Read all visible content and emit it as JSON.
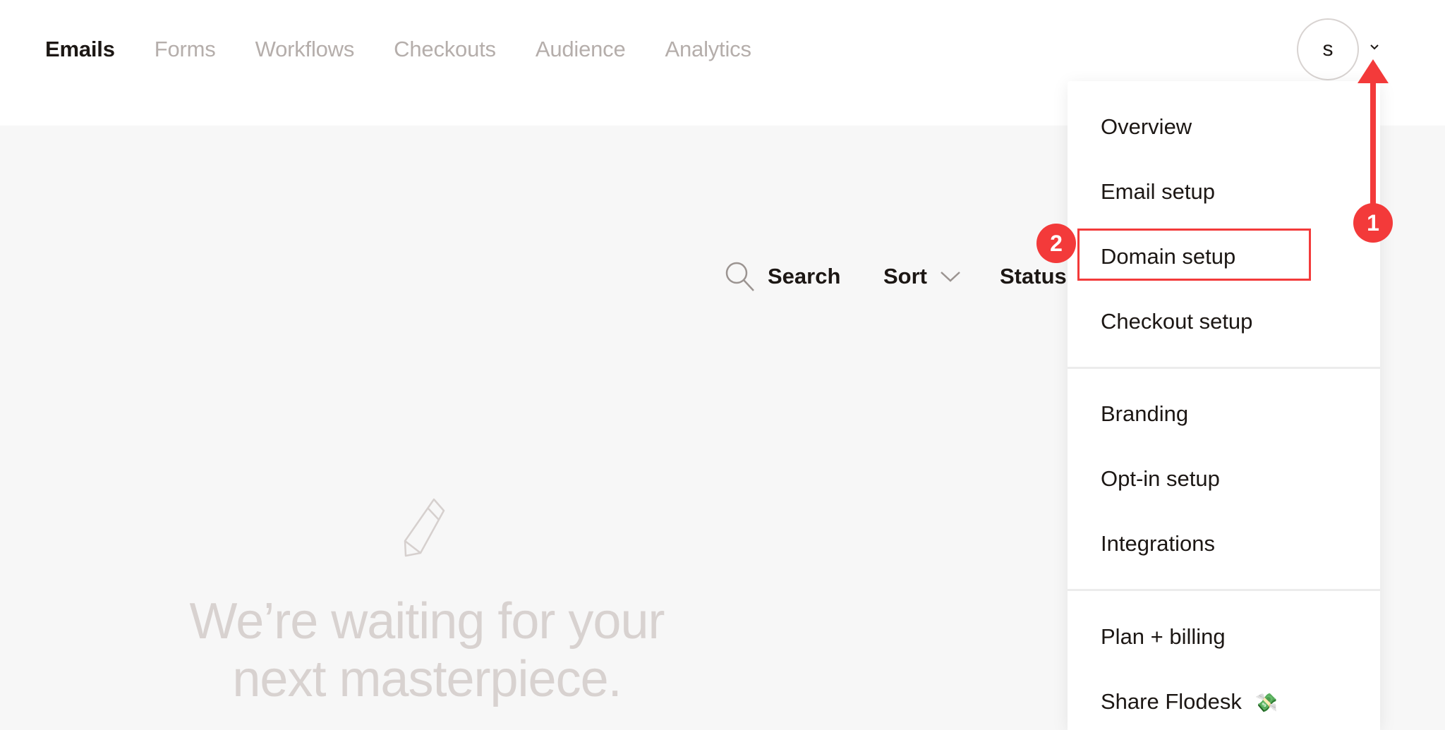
{
  "nav": {
    "items": [
      {
        "label": "Emails",
        "active": true
      },
      {
        "label": "Forms",
        "active": false
      },
      {
        "label": "Workflows",
        "active": false
      },
      {
        "label": "Checkouts",
        "active": false
      },
      {
        "label": "Audience",
        "active": false
      },
      {
        "label": "Analytics",
        "active": false
      }
    ]
  },
  "account": {
    "avatar_initial": "s",
    "chevron_icon": "chevron-down-icon"
  },
  "toolbar": {
    "search_label": "Search",
    "search_icon": "search-icon",
    "sort_label": "Sort",
    "sort_icon": "chevron-down-icon",
    "status_label": "Status"
  },
  "empty_state": {
    "icon": "pencil-icon",
    "headline_line1": "We’re waiting for your",
    "headline_line2": "next masterpiece."
  },
  "account_menu": {
    "groups": [
      [
        "Overview",
        "Email setup",
        "Domain setup",
        "Checkout setup"
      ],
      [
        "Branding",
        "Opt-in setup",
        "Integrations"
      ],
      [
        "Plan + billing",
        "Share Flodesk"
      ]
    ],
    "share_emoji": "💸"
  },
  "annotations": {
    "step1_label": "1",
    "step2_label": "2",
    "highlighted_item": "Domain setup",
    "accent_color": "#f33a3a"
  }
}
